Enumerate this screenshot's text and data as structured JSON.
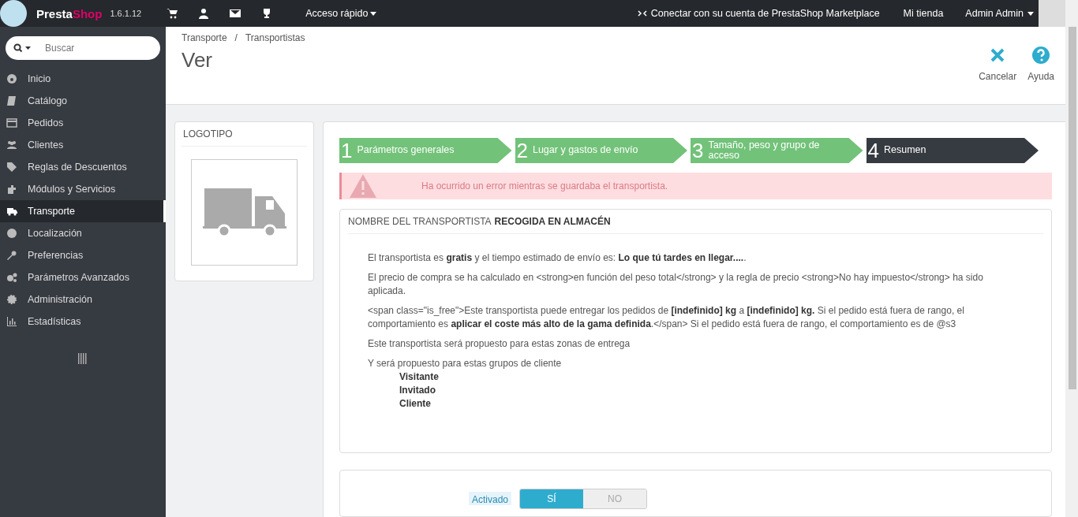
{
  "topbar": {
    "brand_first": "Presta",
    "brand_second": "Shop",
    "version": "1.6.1.12",
    "quick_access": "Acceso rápido",
    "marketplace": "Conectar con su cuenta de PrestaShop Marketplace",
    "my_shop": "Mi tienda",
    "user": "Admin Admin"
  },
  "sidebar": {
    "search": {
      "placeholder": "Buscar"
    },
    "items": [
      {
        "label": "Inicio",
        "selected": false
      },
      {
        "label": "Catálogo",
        "selected": false
      },
      {
        "label": "Pedidos",
        "selected": false
      },
      {
        "label": "Clientes",
        "selected": false
      },
      {
        "label": "Reglas de Descuentos",
        "selected": false
      },
      {
        "label": "Módulos y Servicios",
        "selected": false
      },
      {
        "label": "Transporte",
        "selected": true
      },
      {
        "label": "Localización",
        "selected": false
      },
      {
        "label": "Preferencias",
        "selected": false
      },
      {
        "label": "Parámetros Avanzados",
        "selected": false
      },
      {
        "label": "Administración",
        "selected": false
      },
      {
        "label": "Estadísticas",
        "selected": false
      }
    ]
  },
  "header": {
    "breadcrumb": [
      "Transporte",
      "Transportistas"
    ],
    "breadcrumb_separator": "/",
    "title": "Ver",
    "toolbar": [
      {
        "label": "Cancelar"
      },
      {
        "label": "Ayuda"
      }
    ]
  },
  "logo_panel": {
    "title": "LOGOTIPO"
  },
  "steps": [
    {
      "number": "1",
      "label": "Parámetros generales",
      "selected": false
    },
    {
      "number": "2",
      "label": "Lugar y gastos de envío",
      "selected": false
    },
    {
      "number": "3",
      "label": "Tamaño, peso y grupo de acceso",
      "selected": false
    },
    {
      "number": "4",
      "label": "Resumen",
      "selected": true
    }
  ],
  "alert": "Ha ocurrido un error mientras se guardaba el transportista.",
  "summary": {
    "heading_label": "NOMBRE DEL TRANSPORTISTA",
    "heading_value": "RECOGIDA EN ALMACÉN",
    "paragraphs": [
      "El transportista es **gratis** y el tiempo estimado de envío es: **Lo que tú tardes en llegar....**.",
      "El precio de compra se ha calculado en <strong>en función del peso total</strong> y la regla de precio <strong>No hay impuesto</strong> ha sido aplicada.",
      "<span class=\"is_free\">Este transportista puede entregar los pedidos de **[indefinido] kg** a **[indefinido] kg.** Si el pedido está fuera de rango, el comportamiento es **aplicar el coste más alto de la gama definida**.</span> Si el pedido está fuera de rango, el comportamiento es de @s3",
      "Este transportista será propuesto para estas zonas de entrega"
    ],
    "groups_intro": "Y será propuesto para estas grupos de cliente",
    "groups": [
      "Visitante",
      "Invitado",
      "Cliente"
    ]
  },
  "activation": {
    "label": "Activado",
    "options": [
      {
        "label": "SÍ",
        "selected": true
      },
      {
        "label": "NO",
        "selected": false
      }
    ]
  }
}
